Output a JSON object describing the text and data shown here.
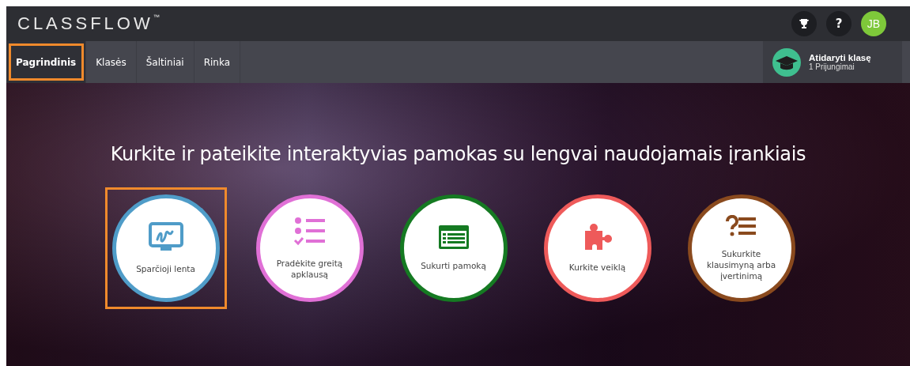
{
  "header": {
    "logo": "CLASSFLOW",
    "logo_mark": "™",
    "avatar": "JB",
    "help": "?"
  },
  "tabs": [
    {
      "label": "Pagrindinis",
      "selected": true,
      "highlighted": true
    },
    {
      "label": "Klasės",
      "selected": false,
      "highlighted": false
    },
    {
      "label": "Šaltiniai",
      "selected": false,
      "highlighted": false
    },
    {
      "label": "Rinka",
      "selected": false,
      "highlighted": false
    }
  ],
  "open_class": {
    "title": "Atidaryti klasę",
    "subtitle": "1 Prijungimai"
  },
  "hero": {
    "headline": "Kurkite ir pateikite interaktyvias pamokas su lengvai naudojamais įrankiais"
  },
  "actions": [
    {
      "kind": "whiteboard",
      "label": "Sparčioji lenta",
      "color": "#4f9cc8",
      "highlighted": true
    },
    {
      "kind": "poll",
      "label": "Pradėkite greitą apklausą",
      "color": "#e070d6",
      "highlighted": false
    },
    {
      "kind": "lesson",
      "label": "Sukurti pamoką",
      "color": "#157a22",
      "highlighted": false
    },
    {
      "kind": "activity",
      "label": "Kurkite veiklą",
      "color": "#ee5a5a",
      "highlighted": false
    },
    {
      "kind": "quiz",
      "label": "Sukurkite klausimyną arba įvertinimą",
      "color": "#8a4a1e",
      "highlighted": false
    }
  ]
}
